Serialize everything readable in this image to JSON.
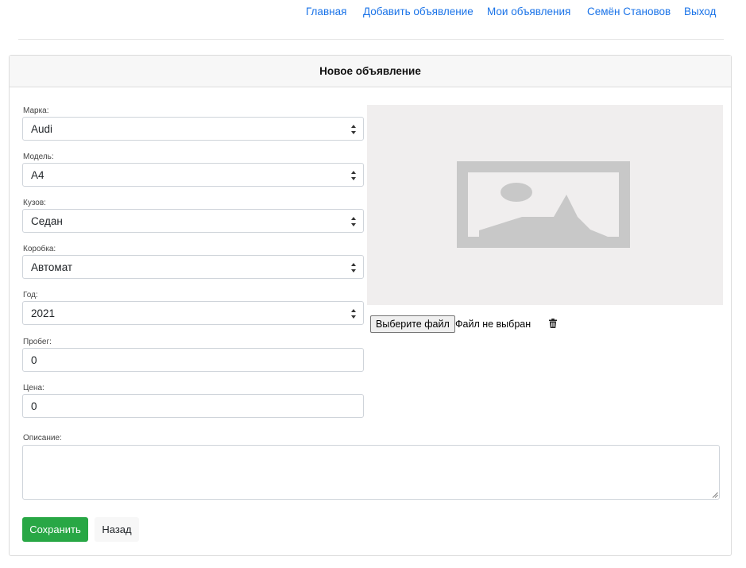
{
  "nav": {
    "home": "Главная",
    "add_listing": "Добавить объявление",
    "my_listings": "Мои объявления",
    "user": "Семён Становов",
    "logout": "Выход"
  },
  "card": {
    "title": "Новое объявление"
  },
  "form": {
    "brand": {
      "label": "Марка:",
      "value": "Audi"
    },
    "model": {
      "label": "Модель:",
      "value": "A4"
    },
    "body": {
      "label": "Кузов:",
      "value": "Седан"
    },
    "gearbox": {
      "label": "Коробка:",
      "value": "Автомат"
    },
    "year": {
      "label": "Год:",
      "value": "2021"
    },
    "mileage": {
      "label": "Пробег:",
      "value": "0"
    },
    "price": {
      "label": "Цена:",
      "value": "0"
    },
    "description": {
      "label": "Описание:",
      "value": ""
    }
  },
  "upload": {
    "choose_label": "Выберите файл",
    "status": "Файл не выбран",
    "delete_icon": "trash-icon",
    "placeholder_icon": "image-placeholder-icon"
  },
  "actions": {
    "save": "Сохранить",
    "back": "Назад"
  },
  "colors": {
    "link": "#1a73e8",
    "save": "#28a745",
    "placeholder_bg": "#f0eeee",
    "placeholder_fg": "#c8c8c8"
  }
}
